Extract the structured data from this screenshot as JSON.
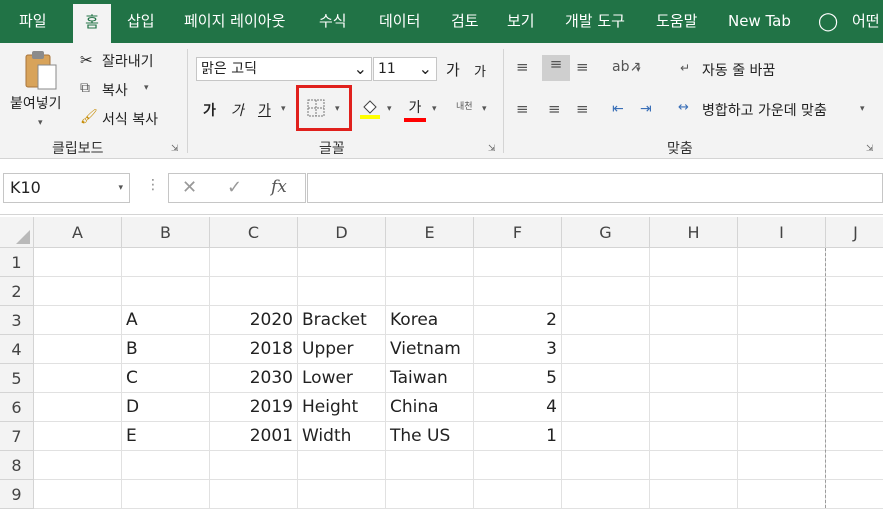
{
  "tabs": [
    "파일",
    "홈",
    "삽입",
    "페이지 레이아웃",
    "수식",
    "데이터",
    "검토",
    "보기",
    "개발 도구",
    "도움말",
    "New Tab",
    "어떤"
  ],
  "clipboard": {
    "paste": "붙여넣기",
    "cut": "잘라내기",
    "copy": "복사",
    "format_painter": "서식 복사",
    "group_label": "클립보드"
  },
  "font": {
    "name": "맑은 고딕",
    "size": "11",
    "grow": "가",
    "shrink": "가",
    "bold": "가",
    "italic": "가",
    "underline": "가",
    "font_color": "가",
    "phonetic": "내천",
    "group_label": "글꼴",
    "highlight_color": "#ffff00",
    "font_color_value": "#ff0000",
    "annotation_color": "#e0201c"
  },
  "alignment": {
    "wrap_text": "자동 줄 바꿈",
    "merge_center": "병합하고 가운데 맞춤",
    "group_label": "맞춤"
  },
  "formula_bar": {
    "name_box": "K10",
    "cancel": "✕",
    "enter": "✓",
    "fx": "fx",
    "formula": ""
  },
  "columns": [
    "A",
    "B",
    "C",
    "D",
    "E",
    "F",
    "G",
    "H",
    "I",
    "J"
  ],
  "rows": [
    "1",
    "2",
    "3",
    "4",
    "5",
    "6",
    "7",
    "8",
    "9"
  ],
  "cells": [
    [
      "",
      "",
      "",
      "",
      "",
      "",
      "",
      "",
      "",
      ""
    ],
    [
      "",
      "",
      "",
      "",
      "",
      "",
      "",
      "",
      "",
      ""
    ],
    [
      "",
      "A",
      "2020",
      "Bracket",
      "Korea",
      "2",
      "",
      "",
      "",
      ""
    ],
    [
      "",
      "B",
      "2018",
      "Upper",
      "Vietnam",
      "3",
      "",
      "",
      "",
      ""
    ],
    [
      "",
      "C",
      "2030",
      "Lower",
      "Taiwan",
      "5",
      "",
      "",
      "",
      ""
    ],
    [
      "",
      "D",
      "2019",
      "Height",
      "China",
      "4",
      "",
      "",
      "",
      ""
    ],
    [
      "",
      "E",
      "2001",
      "Width",
      "The US",
      "1",
      "",
      "",
      "",
      ""
    ],
    [
      "",
      "",
      "",
      "",
      "",
      "",
      "",
      "",
      "",
      ""
    ],
    [
      "",
      "",
      "",
      "",
      "",
      "",
      "",
      "",
      "",
      ""
    ]
  ],
  "colors": {
    "accent": "#217346",
    "gridline": "#e1e1e1",
    "header_bg": "#f3f3f3"
  }
}
